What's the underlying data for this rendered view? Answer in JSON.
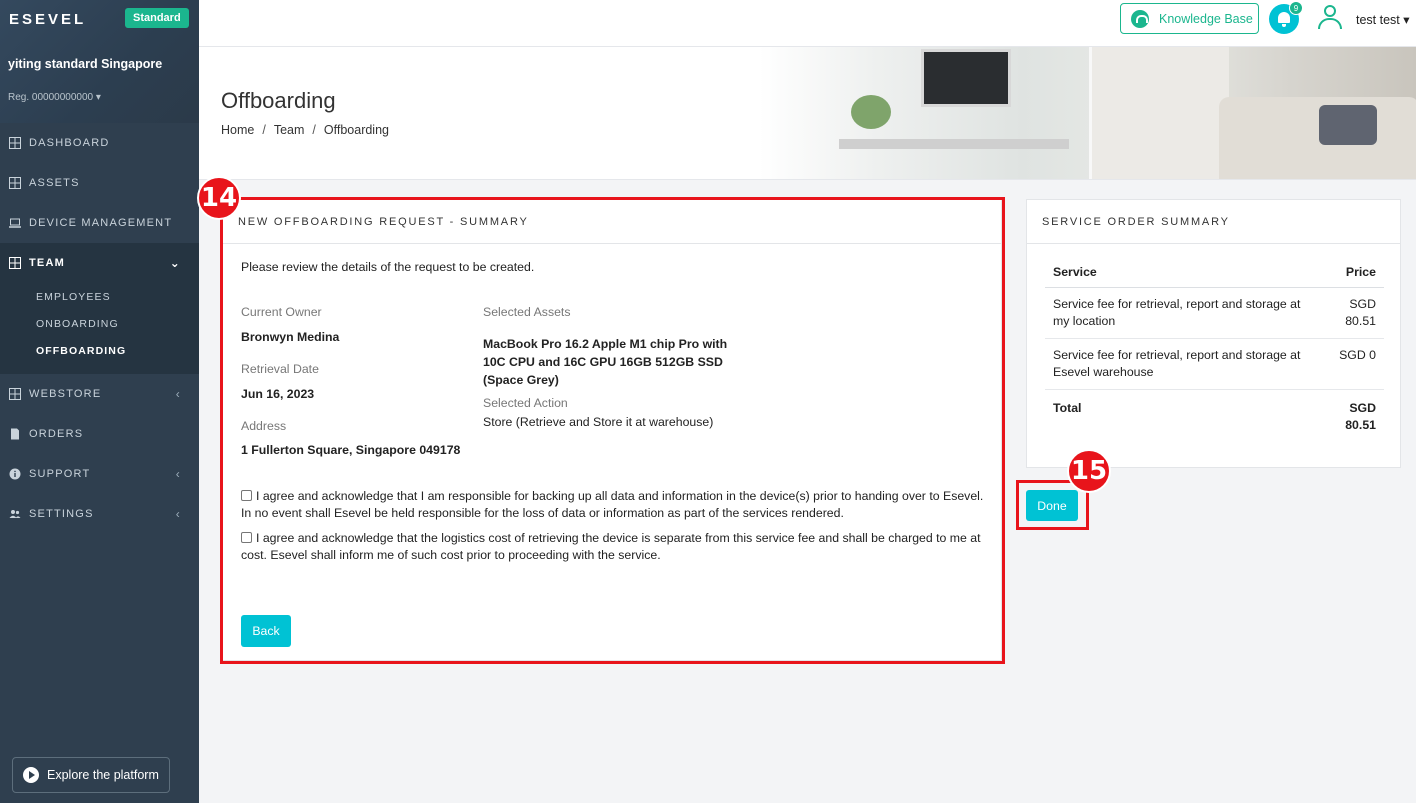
{
  "sidebar": {
    "logo": "ESEVEL",
    "plan_badge": "Standard",
    "org_name": "yiting standard Singapore",
    "org_reg": "Reg. 00000000000",
    "nav": [
      {
        "label": "DASHBOARD"
      },
      {
        "label": "ASSETS"
      },
      {
        "label": "DEVICE MANAGEMENT"
      },
      {
        "label": "TEAM"
      },
      {
        "label": "WEBSTORE"
      },
      {
        "label": "ORDERS"
      },
      {
        "label": "SUPPORT"
      },
      {
        "label": "SETTINGS"
      }
    ],
    "team_sub": [
      {
        "label": "EMPLOYEES"
      },
      {
        "label": "ONBOARDING"
      },
      {
        "label": "OFFBOARDING"
      }
    ],
    "explore_label": "Explore the platform"
  },
  "topbar": {
    "knowledge_base": "Knowledge Base",
    "notification_count": "9",
    "user_name": "test test"
  },
  "header": {
    "title": "Offboarding",
    "breadcrumb": [
      "Home",
      "Team",
      "Offboarding"
    ],
    "breadcrumb_sep": "/"
  },
  "request": {
    "heading": "NEW OFFBOARDING REQUEST - SUMMARY",
    "intro": "Please review the details of the request to be created.",
    "current_owner_label": "Current Owner",
    "current_owner": "Bronwyn Medina",
    "retrieval_date_label": "Retrieval Date",
    "retrieval_date": "Jun 16, 2023",
    "address_label": "Address",
    "address": "1 Fullerton Square, Singapore 049178",
    "selected_assets_label": "Selected Assets",
    "selected_asset_lines": [
      "MacBook Pro 16.2 Apple M1 chip Pro with",
      "10C CPU and 16C GPU 16GB 512GB SSD",
      "(Space Grey)"
    ],
    "selected_action_label": "Selected Action",
    "selected_action": "Store (Retrieve and Store it at warehouse)",
    "agreement_1": "I agree and acknowledge that I am responsible for backing up all data and information in the device(s) prior to handing over to Esevel. In no event shall Esevel be held responsible for the loss of data or information as part of the services rendered.",
    "agreement_2": "I agree and acknowledge that the logistics cost of retrieving the device is separate from this service fee and shall be charged to me at cost. Esevel shall inform me of such cost prior to proceeding with the service.",
    "back_label": "Back"
  },
  "summary": {
    "heading": "SERVICE ORDER SUMMARY",
    "col_service": "Service",
    "col_price": "Price",
    "rows": [
      {
        "service": "Service fee for retrieval, report and storage at my location",
        "price": "SGD 80.51"
      },
      {
        "service": "Service fee for retrieval, report and storage at Esevel warehouse",
        "price": "SGD 0"
      }
    ],
    "total_label": "Total",
    "total_value": "SGD 80.51",
    "done_label": "Done"
  },
  "annotations": {
    "step_14": "14",
    "step_15": "15",
    "color": "#e8141b"
  },
  "colors": {
    "accent": "#00c2d4",
    "brand_green": "#1bb68e",
    "sidebar": "#2f3f4f"
  }
}
